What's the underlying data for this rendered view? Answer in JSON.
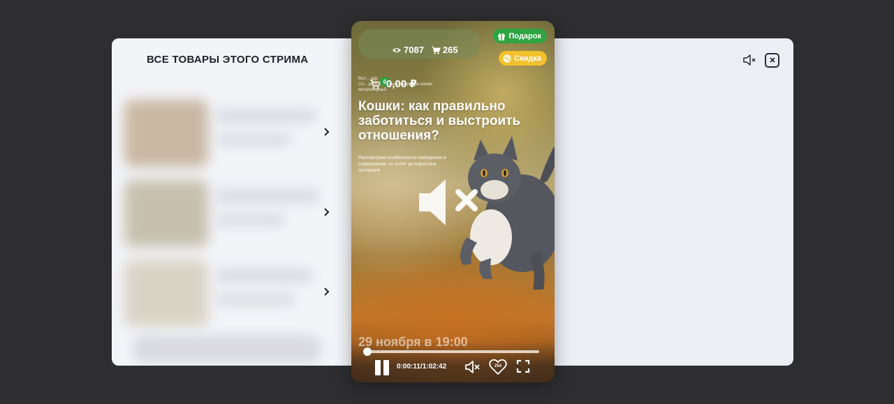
{
  "modal": {
    "title": "ВСЕ ТОВАРЫ ЭТОГО СТРИМА",
    "mute_icon": "speaker-mute-icon",
    "close_icon": "close-icon",
    "products": [
      {
        "thumb_color": "#c9b8a2",
        "chevron": "chevron-right-icon"
      },
      {
        "thumb_color": "#c6c0ad",
        "chevron": "chevron-right-icon"
      },
      {
        "thumb_color": "#d8d4c5",
        "chevron": "chevron-right-icon"
      }
    ]
  },
  "player": {
    "views": "7087",
    "cart_adds": "265",
    "badges": {
      "gift": "Подарок",
      "sale": "Скидка"
    },
    "colors": {
      "gift": "#2ea442",
      "sale": "#f2c12b"
    },
    "cart": {
      "count": "0",
      "sum": "0,00 ₽"
    },
    "tiny_text": "Вол... ддр\nСо... дите... ... иация медицины кошек\nветеринарный",
    "headline": "Кошки: как правильно заботиться и выстроить отношения?",
    "subtitle": "Рассмотрим особенности поведения и содержания, от котят до взрослых питомцев",
    "date": "29 ноября в 19:00",
    "timecode": "0:00:11/1:02:42",
    "progress": 0.003,
    "likes": "254"
  }
}
